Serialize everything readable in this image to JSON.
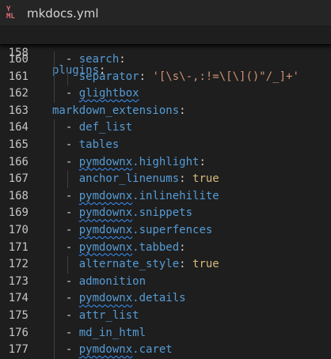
{
  "tab": {
    "icon": "yaml-icon",
    "title": "mkdocs.yml"
  },
  "sticky_line": {
    "number": "158",
    "key": "plugins",
    "colon": ":"
  },
  "lines": [
    {
      "n": "160",
      "indent": 1,
      "dash": "- ",
      "key": "search",
      "rest": ":",
      "type": "key"
    },
    {
      "n": "161",
      "indent": 2,
      "key": "separator",
      "rest": ": ",
      "str": "'[\\s\\-,:!=\\[\\]()\"/_]+'",
      "type": "kv-str"
    },
    {
      "n": "162",
      "indent": 1,
      "dash": "- ",
      "text": "glightbox",
      "type": "val",
      "squiggle": "glightbox"
    },
    {
      "n": "163",
      "indent": 0,
      "key": "markdown_extensions",
      "rest": ":",
      "type": "key"
    },
    {
      "n": "164",
      "indent": 1,
      "dash": "- ",
      "text": "def_list",
      "type": "val"
    },
    {
      "n": "165",
      "indent": 1,
      "dash": "- ",
      "text": "tables",
      "type": "val"
    },
    {
      "n": "166",
      "indent": 1,
      "dash": "- ",
      "key": "pymdownx.highlight",
      "rest": ":",
      "type": "key"
    },
    {
      "n": "167",
      "indent": 2,
      "key": "anchor_linenums",
      "rest": ": ",
      "bool": "true",
      "type": "kv-bool"
    },
    {
      "n": "168",
      "indent": 1,
      "dash": "- ",
      "text": "pymdownx.inlinehilite",
      "type": "val"
    },
    {
      "n": "169",
      "indent": 1,
      "dash": "- ",
      "text": "pymdownx.snippets",
      "type": "val"
    },
    {
      "n": "170",
      "indent": 1,
      "dash": "- ",
      "text": "pymdownx.superfences",
      "type": "val"
    },
    {
      "n": "171",
      "indent": 1,
      "dash": "- ",
      "key": "pymdownx.tabbed",
      "rest": ":",
      "type": "key"
    },
    {
      "n": "172",
      "indent": 2,
      "key": "alternate_style",
      "rest": ": ",
      "bool": "true",
      "type": "kv-bool"
    },
    {
      "n": "173",
      "indent": 1,
      "dash": "- ",
      "text": "admonition",
      "type": "val"
    },
    {
      "n": "174",
      "indent": 1,
      "dash": "- ",
      "text": "pymdownx.details",
      "type": "val"
    },
    {
      "n": "175",
      "indent": 1,
      "dash": "- ",
      "text": "attr_list",
      "type": "val"
    },
    {
      "n": "176",
      "indent": 1,
      "dash": "- ",
      "text": "md_in_html",
      "type": "val"
    },
    {
      "n": "177",
      "indent": 1,
      "dash": "- ",
      "text": "pymdownx.caret",
      "type": "val"
    }
  ],
  "colors": {
    "background": "#1e1e1e",
    "key": "#569cd6",
    "string": "#ce9178",
    "boolean": "#d7ba7d",
    "squiggle": "#3794ff"
  }
}
